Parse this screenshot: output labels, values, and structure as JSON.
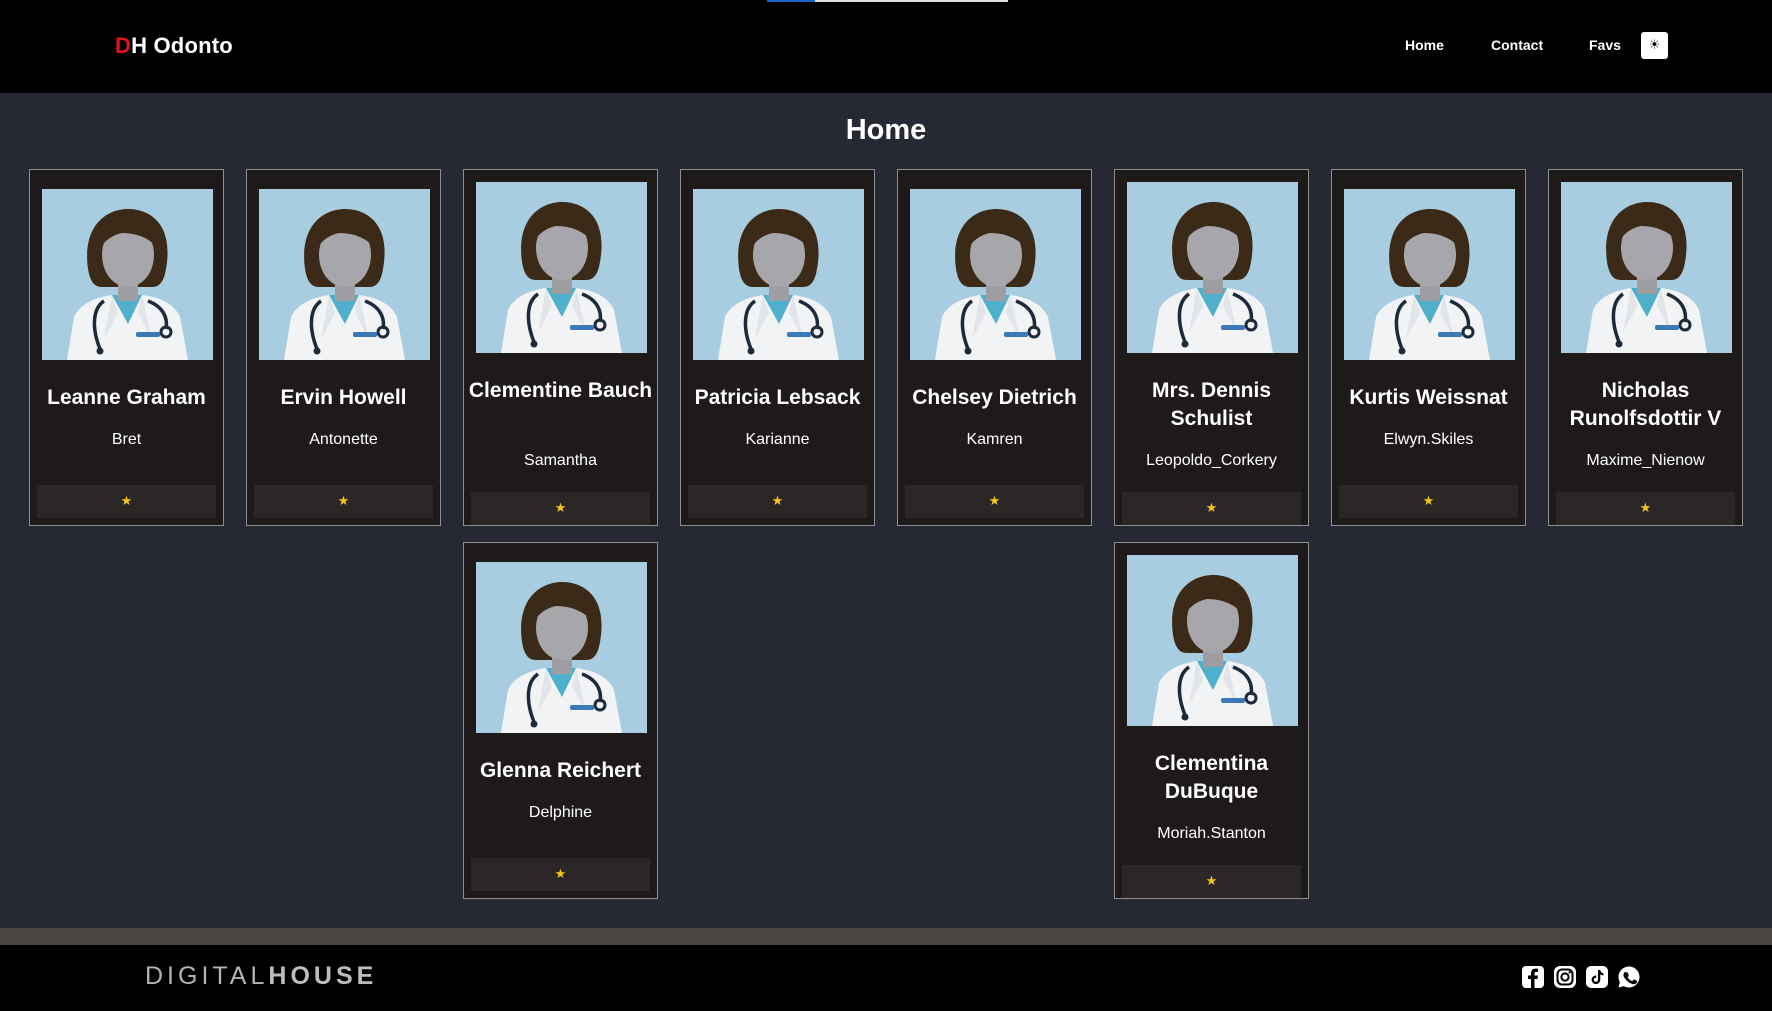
{
  "header": {
    "brand_accent": "D",
    "brand_rest": "H Odonto",
    "nav": [
      {
        "label": "Home"
      },
      {
        "label": "Contact"
      },
      {
        "label": "Favs"
      }
    ],
    "theme_toggle_icon": "☀",
    "load_progress": 0.2
  },
  "page": {
    "title": "Home"
  },
  "dentists": [
    {
      "name": "Leanne Graham",
      "username": "Bret",
      "fav": "★"
    },
    {
      "name": "Ervin Howell",
      "username": "Antonette",
      "fav": "★"
    },
    {
      "name": "Clementine Bauch",
      "username": "Samantha",
      "fav": "★"
    },
    {
      "name": "Patricia Lebsack",
      "username": "Karianne",
      "fav": "★"
    },
    {
      "name": "Chelsey Dietrich",
      "username": "Kamren",
      "fav": "★"
    },
    {
      "name": "Mrs. Dennis Schulist",
      "username": "Leopoldo_Corkery",
      "fav": "★"
    },
    {
      "name": "Kurtis Weissnat",
      "username": "Elwyn.Skiles",
      "fav": "★"
    },
    {
      "name": "Nicholas Runolfsdottir V",
      "username": "Maxime_Nienow",
      "fav": "★"
    },
    {
      "name": "Glenna Reichert",
      "username": "Delphine",
      "fav": "★"
    },
    {
      "name": "Clementina DuBuque",
      "username": "Moriah.Stanton",
      "fav": "★"
    }
  ],
  "footer": {
    "logo_light": "DIGITAL",
    "logo_bold": "HOUSE",
    "social_icons": [
      "facebook-icon",
      "instagram-icon",
      "tiktok-icon",
      "whatsapp-icon"
    ]
  },
  "colors": {
    "accent": "#e0141a",
    "star": "#f5c518",
    "page_bg": "#262833",
    "card_bg": "#1f1a1a"
  }
}
